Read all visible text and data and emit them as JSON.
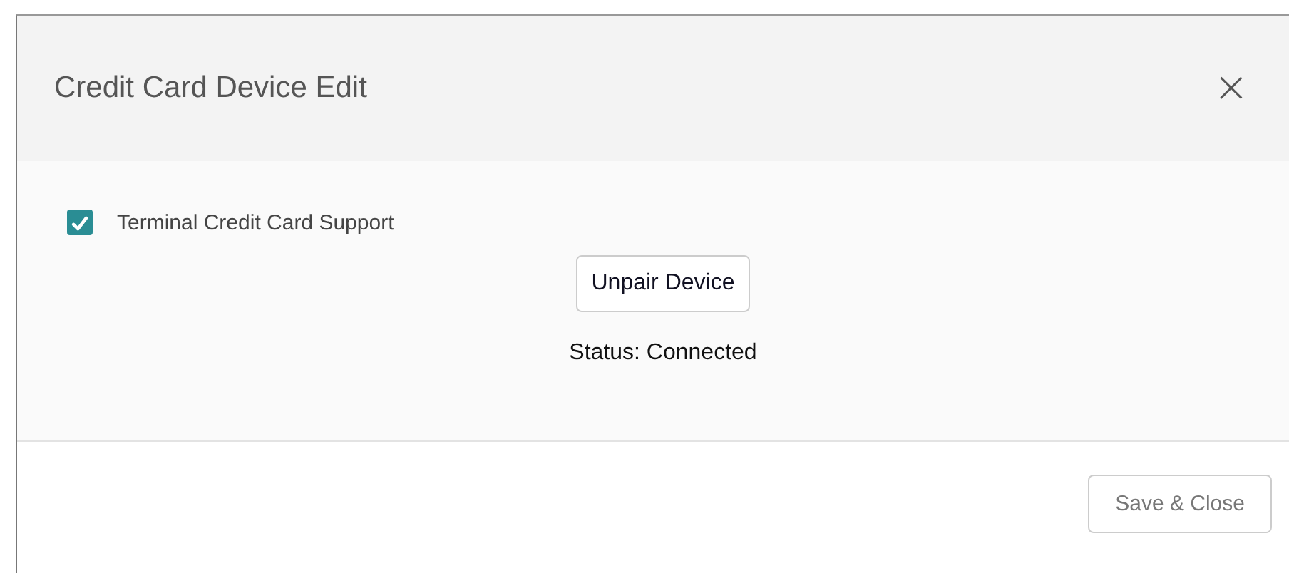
{
  "dialog": {
    "title": "Credit Card Device Edit",
    "close": "×",
    "checkbox": {
      "label": "Terminal Credit Card Support",
      "checked": true
    },
    "unpair_button": "Unpair Device",
    "status": "Status: Connected",
    "footer_button": {
      "label": "Save & Close",
      "disabled": true
    }
  }
}
